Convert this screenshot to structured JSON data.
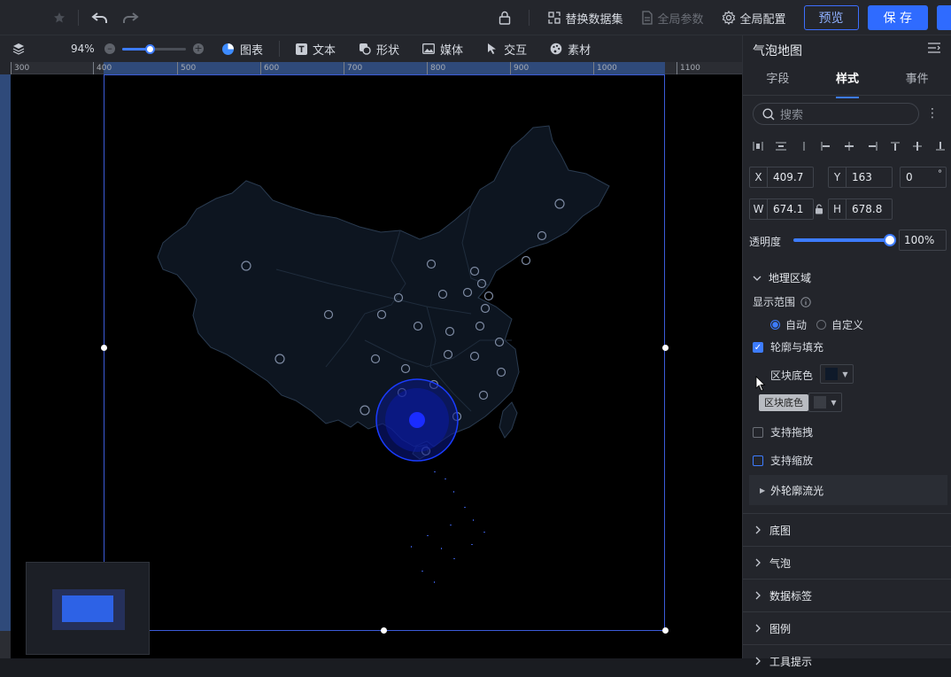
{
  "topbar": {
    "replace_dataset": "替换数据集",
    "global_params": "全局参数",
    "global_config": "全局配置",
    "preview": "预览",
    "save": "保 存"
  },
  "toolbar": {
    "zoom": "94%",
    "tools": [
      "图表",
      "文本",
      "形状",
      "媒体",
      "交互",
      "素材"
    ]
  },
  "ruler": {
    "ticks": [
      "300",
      "400",
      "500",
      "600",
      "700",
      "800",
      "900",
      "1000",
      "1100"
    ]
  },
  "map": {
    "bubble_color": "#1a2cff",
    "region_fill": "#0d1520",
    "region_stroke": "#2a3b50"
  },
  "panel": {
    "title": "气泡地图",
    "tabs": [
      "字段",
      "样式",
      "事件"
    ],
    "active_tab": "样式",
    "search_placeholder": "搜索",
    "x_label": "X",
    "x_value": "409.7",
    "y_label": "Y",
    "y_value": "163",
    "rotation": "0",
    "rotation_unit": "°",
    "w_label": "W",
    "w_value": "674.1",
    "h_label": "H",
    "h_value": "678.8",
    "opacity_label": "透明度",
    "opacity_value": "100%",
    "geo_section": "地理区域",
    "display_range": "显示范围",
    "auto": "自动",
    "custom": "自定义",
    "outline_fill": "轮廓与填充",
    "block_color": "区块底色",
    "tooltip": "区块底色",
    "drag": "支持拖拽",
    "zoom_support": "支持缩放",
    "outline_glow": "外轮廓流光",
    "sections": [
      "底图",
      "气泡",
      "数据标签",
      "图例",
      "工具提示"
    ]
  }
}
